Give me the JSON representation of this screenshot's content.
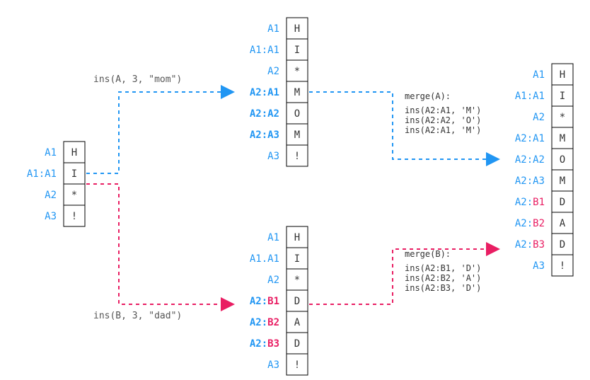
{
  "col1": {
    "cells": [
      "H",
      "I",
      "*",
      "!"
    ],
    "ids": [
      "A1",
      "A1:A1",
      "A2",
      "A3"
    ]
  },
  "opA": "ins(A, 3, \"mom\")",
  "opB": "ins(B, 3, \"dad\")",
  "col2top": {
    "cells": [
      "H",
      "I",
      "*",
      "M",
      "O",
      "M",
      "!"
    ],
    "ids": [
      "A1",
      "A1:A1",
      "A2",
      "A2:A1",
      "A2:A2",
      "A2:A3",
      "A3"
    ]
  },
  "col2bot": {
    "cells": [
      "H",
      "I",
      "*",
      "D",
      "A",
      "D",
      "!"
    ],
    "ids": [
      "A1",
      "A1.A1",
      "A2",
      "A2:B1",
      "A2:B2",
      "A2:B3",
      "A3"
    ]
  },
  "mergeA": {
    "title": "merge(A):",
    "lines": [
      "ins(A2:A1, 'M')",
      "ins(A2:A2, 'O')",
      "ins(A2:A1, 'M')"
    ]
  },
  "mergeB": {
    "title": "merge(B):",
    "lines": [
      "ins(A2:B1, 'D')",
      "ins(A2:B2, 'A')",
      "ins(A2:B3, 'D')"
    ]
  },
  "col3": {
    "cells": [
      "H",
      "I",
      "*",
      "M",
      "O",
      "M",
      "D",
      "A",
      "D",
      "!"
    ],
    "ids": [
      "A1",
      "A1:A1",
      "A2",
      "A2:A1",
      "A2:A2",
      "A2:A3",
      "A2:B1",
      "A2:B2",
      "A2:B3",
      "A3"
    ]
  }
}
